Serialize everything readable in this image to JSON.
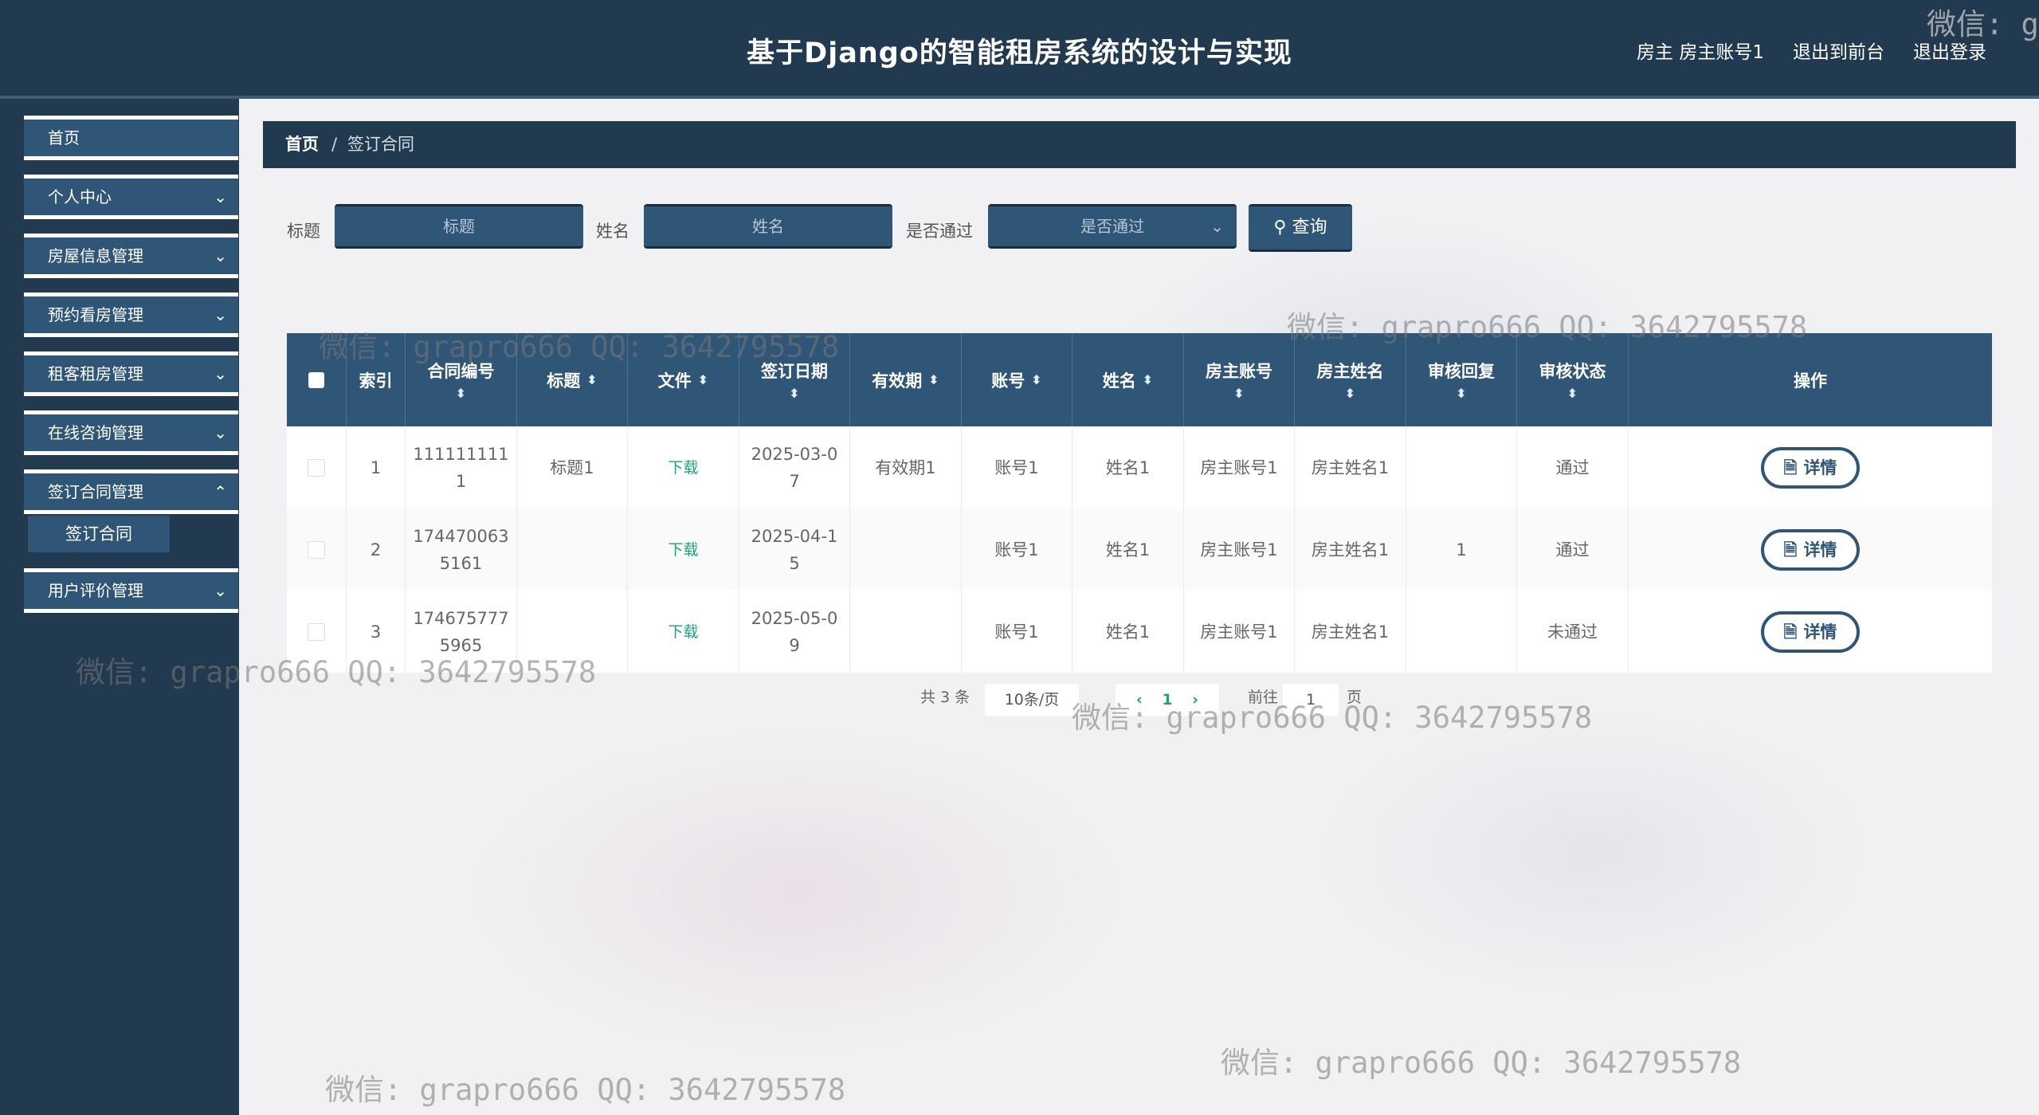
{
  "header": {
    "title": "基于Django的智能租房系统的设计与实现",
    "user_label": "房主 房主账号1",
    "front_link": "退出到前台",
    "logout_link": "退出登录"
  },
  "sidebar": {
    "items": [
      {
        "label": "首页",
        "expandable": false
      },
      {
        "label": "个人中心",
        "expandable": true
      },
      {
        "label": "房屋信息管理",
        "expandable": true
      },
      {
        "label": "预约看房管理",
        "expandable": true
      },
      {
        "label": "租客租房管理",
        "expandable": true
      },
      {
        "label": "在线咨询管理",
        "expandable": true
      },
      {
        "label": "签订合同管理",
        "expandable": true
      },
      {
        "label": "用户评价管理",
        "expandable": true
      }
    ],
    "sub_item": "签订合同"
  },
  "breadcrumb": {
    "home": "首页",
    "separator": "/",
    "current": "签订合同"
  },
  "search": {
    "title_label": "标题",
    "title_placeholder": "标题",
    "name_label": "姓名",
    "name_placeholder": "姓名",
    "pass_label": "是否通过",
    "pass_placeholder": "是否通过",
    "query_button": "查询"
  },
  "table": {
    "headers": [
      "索引",
      "合同编号",
      "标题",
      "文件",
      "签订日期",
      "有效期",
      "账号",
      "姓名",
      "房主账号",
      "房主姓名",
      "审核回复",
      "审核状态",
      "操作"
    ],
    "rows": [
      {
        "index": "1",
        "contract_no": "111111111\n1",
        "title": "标题1",
        "file": "下载",
        "date": "2025-03-0\n7",
        "validity": "有效期1",
        "account": "账号1",
        "name": "姓名1",
        "owner_account": "房主账号1",
        "owner_name": "房主姓名1",
        "reply": "",
        "status": "通过",
        "action": "详情"
      },
      {
        "index": "2",
        "contract_no": "174470063\n5161",
        "title": "",
        "file": "下载",
        "date": "2025-04-1\n5",
        "validity": "",
        "account": "账号1",
        "name": "姓名1",
        "owner_account": "房主账号1",
        "owner_name": "房主姓名1",
        "reply": "1",
        "status": "通过",
        "action": "详情"
      },
      {
        "index": "3",
        "contract_no": "174675777\n5965",
        "title": "",
        "file": "下载",
        "date": "2025-05-0\n9",
        "validity": "",
        "account": "账号1",
        "name": "姓名1",
        "owner_account": "房主账号1",
        "owner_name": "房主姓名1",
        "reply": "",
        "status": "未通过",
        "action": "详情"
      }
    ]
  },
  "pagination": {
    "total": "共 3 条",
    "page_size": "10条/页",
    "current_page": "1",
    "goto_label": "前往",
    "goto_value": "1",
    "page_suffix": "页"
  },
  "watermark": "微信: grapro666 QQ: 3642795578",
  "watermark_corner": "微信: g",
  "colors": {
    "navy": "#223a50",
    "steel_blue": "#2f5677",
    "link_green": "#1aa37a"
  }
}
